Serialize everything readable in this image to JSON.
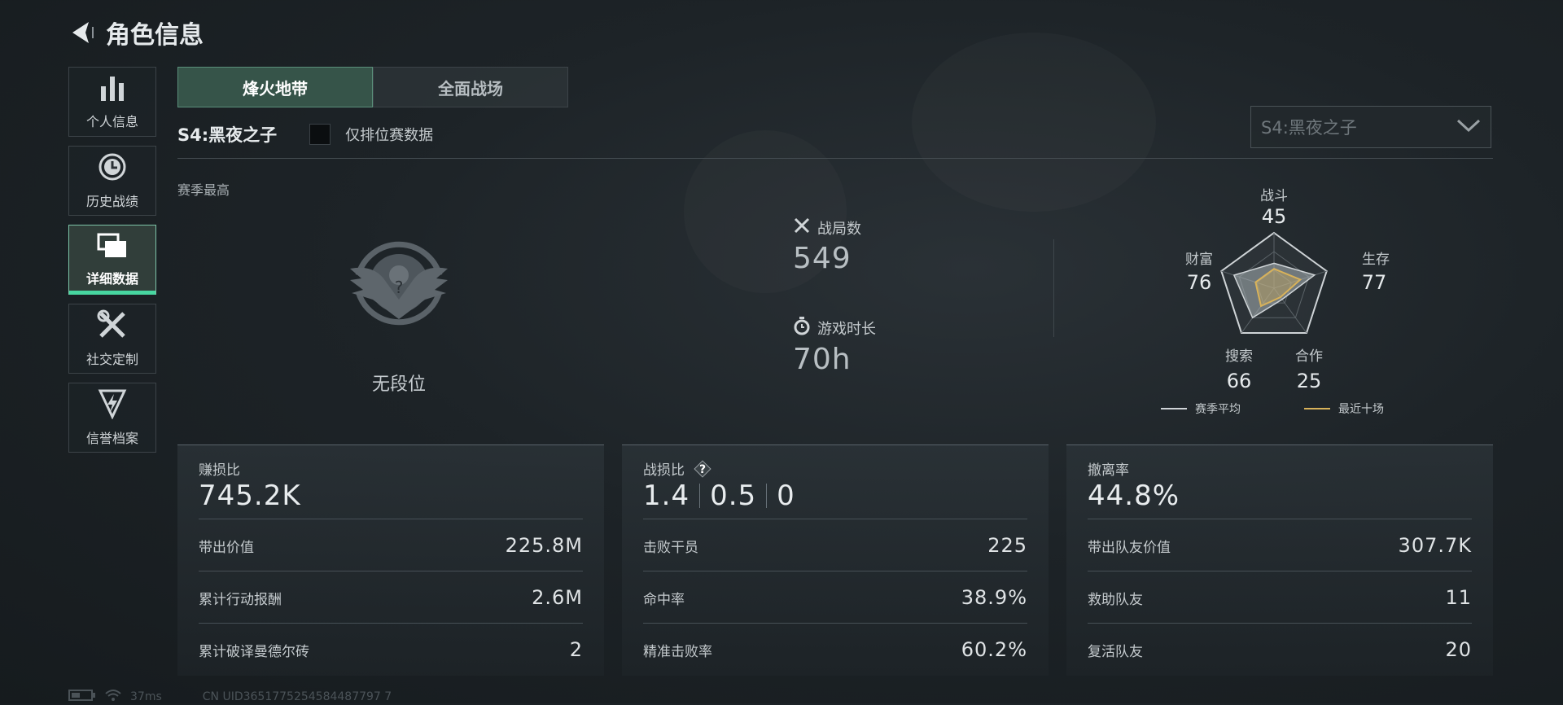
{
  "header": {
    "title": "角色信息"
  },
  "sidebar": {
    "items": [
      {
        "label": "个人信息",
        "icon": "bar-chart-icon"
      },
      {
        "label": "历史战绩",
        "icon": "history-clock-icon"
      },
      {
        "label": "详细数据",
        "icon": "folders-icon",
        "active": true
      },
      {
        "label": "社交定制",
        "icon": "tools-icon"
      },
      {
        "label": "信誉档案",
        "icon": "shield-bolt-icon"
      }
    ]
  },
  "tabs": [
    {
      "label": "烽火地带",
      "active": true
    },
    {
      "label": "全面战场",
      "active": false
    }
  ],
  "season": {
    "label": "S4:黑夜之子",
    "ranked_only_label": "仅排位赛数据",
    "ranked_only_checked": false
  },
  "dropdown": {
    "value": "S4:黑夜之子"
  },
  "season_best": {
    "label": "赛季最高",
    "rank": "无段位"
  },
  "overview": {
    "matches_label": "战局数",
    "matches_value": "549",
    "playtime_label": "游戏时长",
    "playtime_value": "70h"
  },
  "radar": {
    "axes": [
      {
        "name": "战斗",
        "value": "45"
      },
      {
        "name": "生存",
        "value": "77"
      },
      {
        "name": "合作",
        "value": "25"
      },
      {
        "name": "搜索",
        "value": "66"
      },
      {
        "name": "财富",
        "value": "76"
      }
    ],
    "recent_values": [
      0.35,
      0.5,
      0.2,
      0.4,
      0.35
    ],
    "legend_season": "赛季平均",
    "legend_recent": "最近十场",
    "colors": {
      "season": "#cfd4d7",
      "recent": "#d8b25a"
    }
  },
  "cards": [
    {
      "title": "赚损比",
      "value": "745.2K",
      "rows": [
        {
          "label": "带出价值",
          "value": "225.8M"
        },
        {
          "label": "累计行动报酬",
          "value": "2.6M"
        },
        {
          "label": "累计破译曼德尔砖",
          "value": "2"
        }
      ]
    },
    {
      "title": "战损比",
      "values": [
        "1.4",
        "0.5",
        "0"
      ],
      "help": "?",
      "rows": [
        {
          "label": "击败干员",
          "value": "225"
        },
        {
          "label": "命中率",
          "value": "38.9%"
        },
        {
          "label": "精准击败率",
          "value": "60.2%"
        }
      ]
    },
    {
      "title": "撤离率",
      "value": "44.8%",
      "rows": [
        {
          "label": "带出队友价值",
          "value": "307.7K"
        },
        {
          "label": "救助队友",
          "value": "11"
        },
        {
          "label": "复活队友",
          "value": "20"
        }
      ]
    }
  ],
  "footer": {
    "ping": "37ms",
    "uid": "CN UID3651775254584487797 7"
  }
}
